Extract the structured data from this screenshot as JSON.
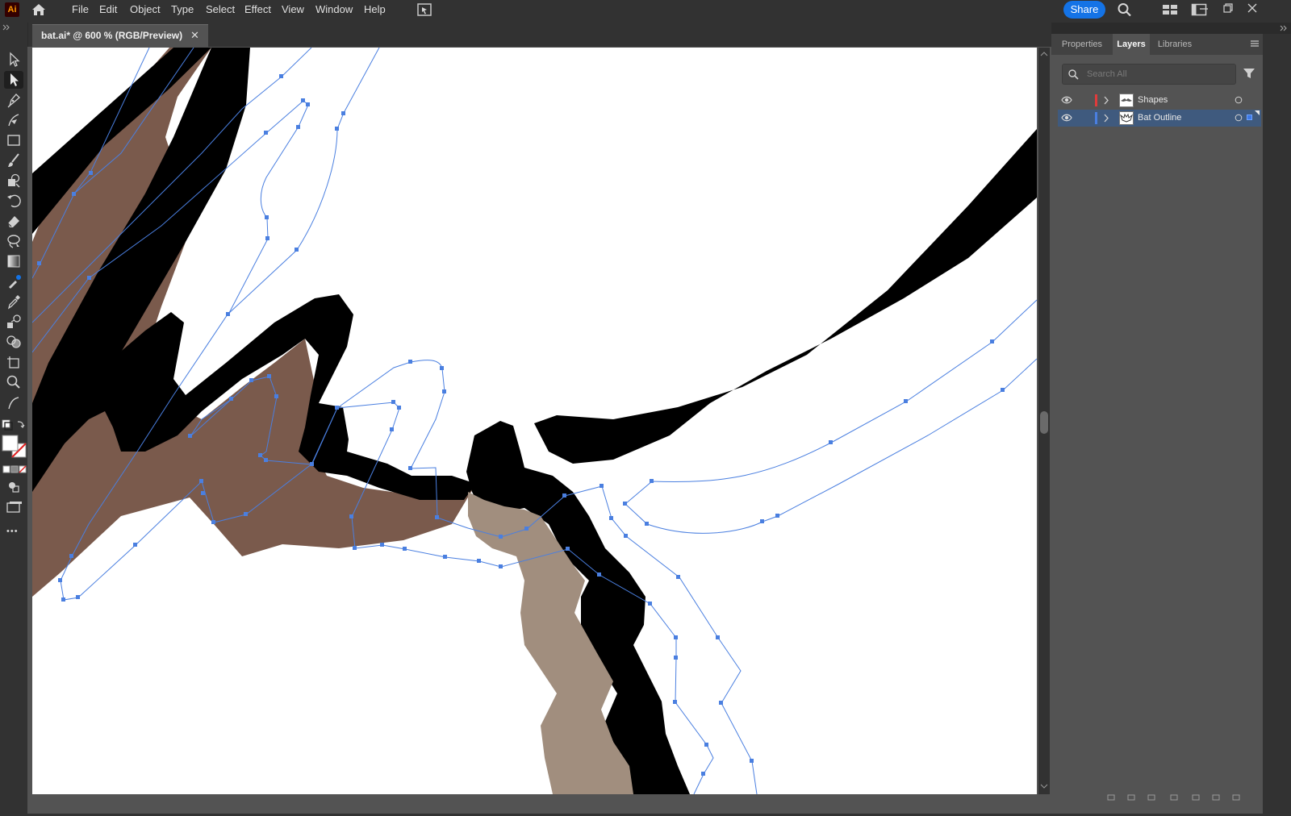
{
  "app": {
    "logo_text": "Ai",
    "menu": [
      "File",
      "Edit",
      "Object",
      "Type",
      "Select",
      "Effect",
      "View",
      "Window",
      "Help"
    ],
    "share_label": "Share"
  },
  "document": {
    "tab_title": "bat.ai* @ 600 % (RGB/Preview)",
    "close_glyph": "✕"
  },
  "toolbar": {
    "tools": [
      "selection-tool",
      "direct-selection-tool",
      "pen-tool",
      "curvature-tool",
      "rectangle-tool",
      "paintbrush-tool",
      "shaper-tool",
      "rotate-tool",
      "eraser-tool",
      "lasso-tool",
      "gradient-tool",
      "eyedropper-tool",
      "blend-tool",
      "shape-builder-tool",
      "symbol-sprayer-tool",
      "artboard-tool",
      "zoom-tool",
      "width-tool"
    ],
    "active_tool": "direct-selection-tool",
    "more_glyph": "•••"
  },
  "panel": {
    "tabs": [
      "Properties",
      "Layers",
      "Libraries"
    ],
    "active_tab": "Layers",
    "search_placeholder": "Search All",
    "layers": [
      {
        "name": "Shapes",
        "color": "#e03b3b",
        "selected": false
      },
      {
        "name": "Bat Outline",
        "color": "#4a7fe0",
        "selected": true
      }
    ]
  },
  "colors": {
    "accent": "#1473e6",
    "path_blue": "#4a7fe0",
    "wing_brown": "#7a5a4c",
    "bat_taupe": "#a18e7e"
  }
}
